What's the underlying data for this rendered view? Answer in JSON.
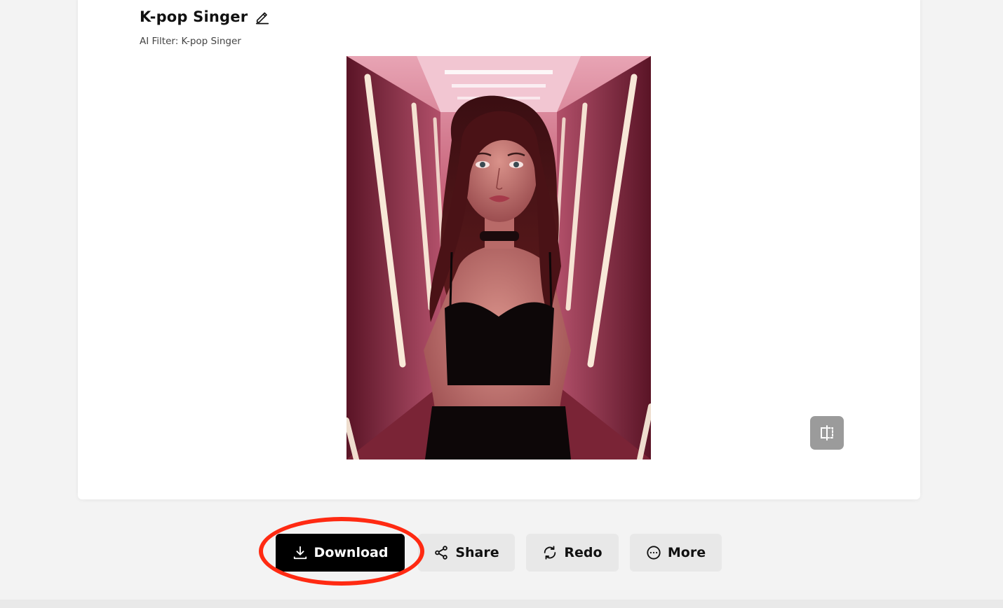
{
  "result": {
    "title": "K-pop Singer",
    "subtitle": "AI Filter: K-pop Singer"
  },
  "icons": {
    "edit": "pencil-icon",
    "compare": "compare-split-icon",
    "download": "download-icon",
    "share": "share-icon",
    "redo": "redo-icon",
    "more": "more-icon"
  },
  "actions": {
    "download_label": "Download",
    "share_label": "Share",
    "redo_label": "Redo",
    "more_label": "More"
  },
  "colors": {
    "primary_button": "#000000",
    "secondary_button": "#e8e8e8",
    "highlight": "#ff2a12",
    "page_background": "#f3f3f3"
  }
}
